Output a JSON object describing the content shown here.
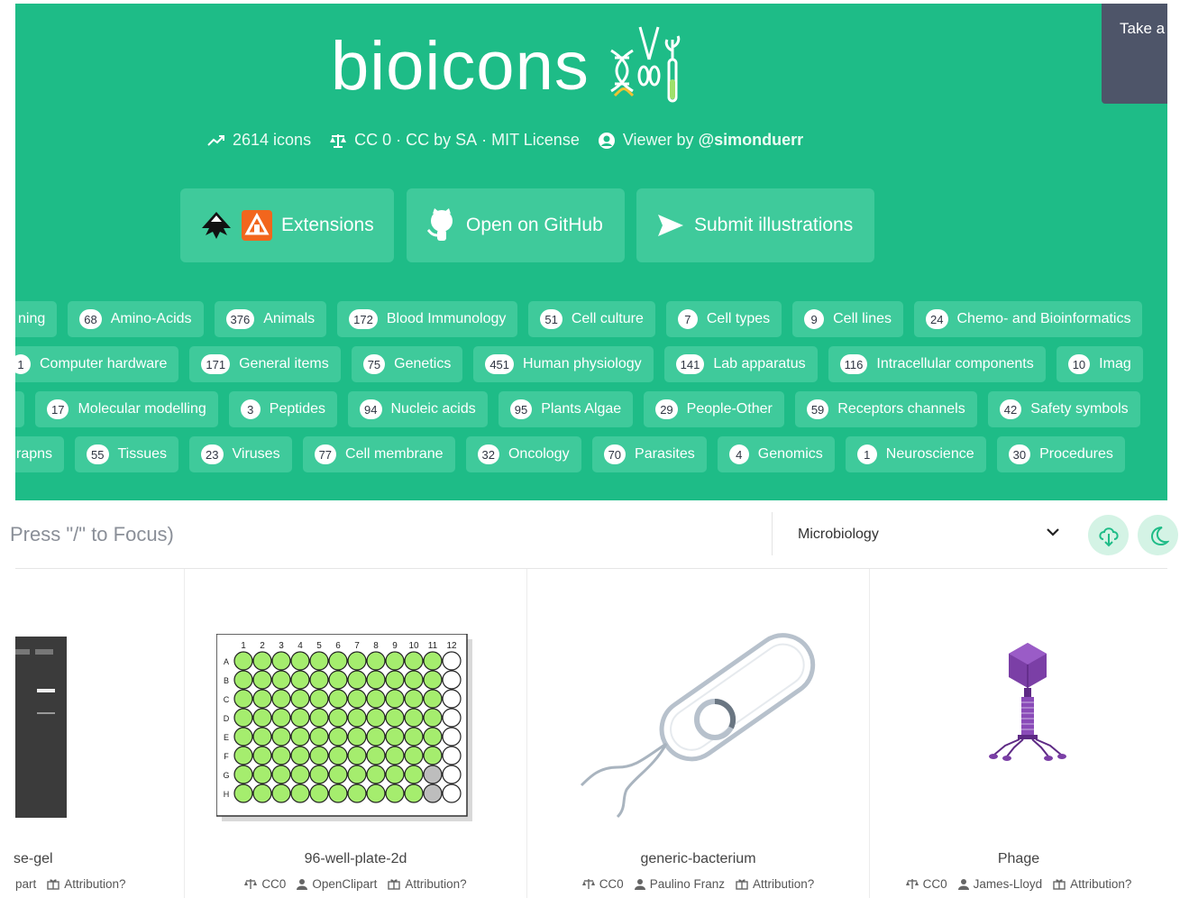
{
  "header": {
    "logo_text": "bioicons",
    "take_label": "Take a",
    "icon_count": "2614 icons",
    "license_cc0": "CC 0",
    "license_sep1": " · ",
    "license_ccbysa": "CC by SA",
    "license_sep2": " · ",
    "license_mit": "MIT License",
    "viewer_prefix": "Viewer by ",
    "viewer_handle": "@simonduerr"
  },
  "buttons": {
    "extensions": "Extensions",
    "github": "Open on GitHub",
    "submit": "Submit illustrations"
  },
  "tag_rows": [
    [
      {
        "count": "",
        "label": "ning"
      },
      {
        "count": "68",
        "label": "Amino-Acids"
      },
      {
        "count": "376",
        "label": "Animals"
      },
      {
        "count": "172",
        "label": "Blood Immunology"
      },
      {
        "count": "51",
        "label": "Cell culture"
      },
      {
        "count": "7",
        "label": "Cell types"
      },
      {
        "count": "9",
        "label": "Cell lines"
      },
      {
        "count": "24",
        "label": "Chemo- and Bioinformatics"
      }
    ],
    [
      {
        "count": "1",
        "label": "Computer hardware"
      },
      {
        "count": "171",
        "label": "General items"
      },
      {
        "count": "75",
        "label": "Genetics"
      },
      {
        "count": "451",
        "label": "Human physiology"
      },
      {
        "count": "141",
        "label": "Lab apparatus"
      },
      {
        "count": "116",
        "label": "Intracellular components"
      },
      {
        "count": "10",
        "label": "Imag"
      }
    ],
    [
      {
        "count": "",
        "label": ""
      },
      {
        "count": "17",
        "label": "Molecular modelling"
      },
      {
        "count": "3",
        "label": "Peptides"
      },
      {
        "count": "94",
        "label": "Nucleic acids"
      },
      {
        "count": "95",
        "label": "Plants Algae"
      },
      {
        "count": "29",
        "label": "People-Other"
      },
      {
        "count": "59",
        "label": "Receptors channels"
      },
      {
        "count": "42",
        "label": "Safety symbols"
      }
    ],
    [
      {
        "count": "",
        "label": "rapns"
      },
      {
        "count": "55",
        "label": "Tissues"
      },
      {
        "count": "23",
        "label": "Viruses"
      },
      {
        "count": "77",
        "label": "Cell membrane"
      },
      {
        "count": "32",
        "label": "Oncology"
      },
      {
        "count": "70",
        "label": "Parasites"
      },
      {
        "count": "4",
        "label": "Genomics"
      },
      {
        "count": "1",
        "label": "Neuroscience"
      },
      {
        "count": "30",
        "label": "Procedures"
      }
    ]
  ],
  "search": {
    "placeholder_visible": "Press \"/\" to Focus)",
    "category_value": "Microbiology"
  },
  "cards": [
    {
      "name": "se-gel",
      "license": "",
      "author": "part",
      "attribution": "Attribution?"
    },
    {
      "name": "96-well-plate-2d",
      "license": "CC0",
      "author": "OpenClipart",
      "attribution": "Attribution?"
    },
    {
      "name": "generic-bacterium",
      "license": "CC0",
      "author": "Paulino Franz",
      "attribution": "Attribution?"
    },
    {
      "name": "Phage",
      "license": "CC0",
      "author": "James-Lloyd",
      "attribution": "Attribution?"
    }
  ],
  "plate": {
    "columns": [
      "1",
      "2",
      "3",
      "4",
      "5",
      "6",
      "7",
      "8",
      "9",
      "10",
      "11",
      "12"
    ],
    "rows": [
      "A",
      "B",
      "C",
      "D",
      "E",
      "F",
      "G",
      "H"
    ]
  },
  "colors": {
    "brand_green": "#1ebc87",
    "button_green": "#3fca9b",
    "well_green": "#a5ed6e",
    "phage_purple": "#7b3fa6"
  }
}
